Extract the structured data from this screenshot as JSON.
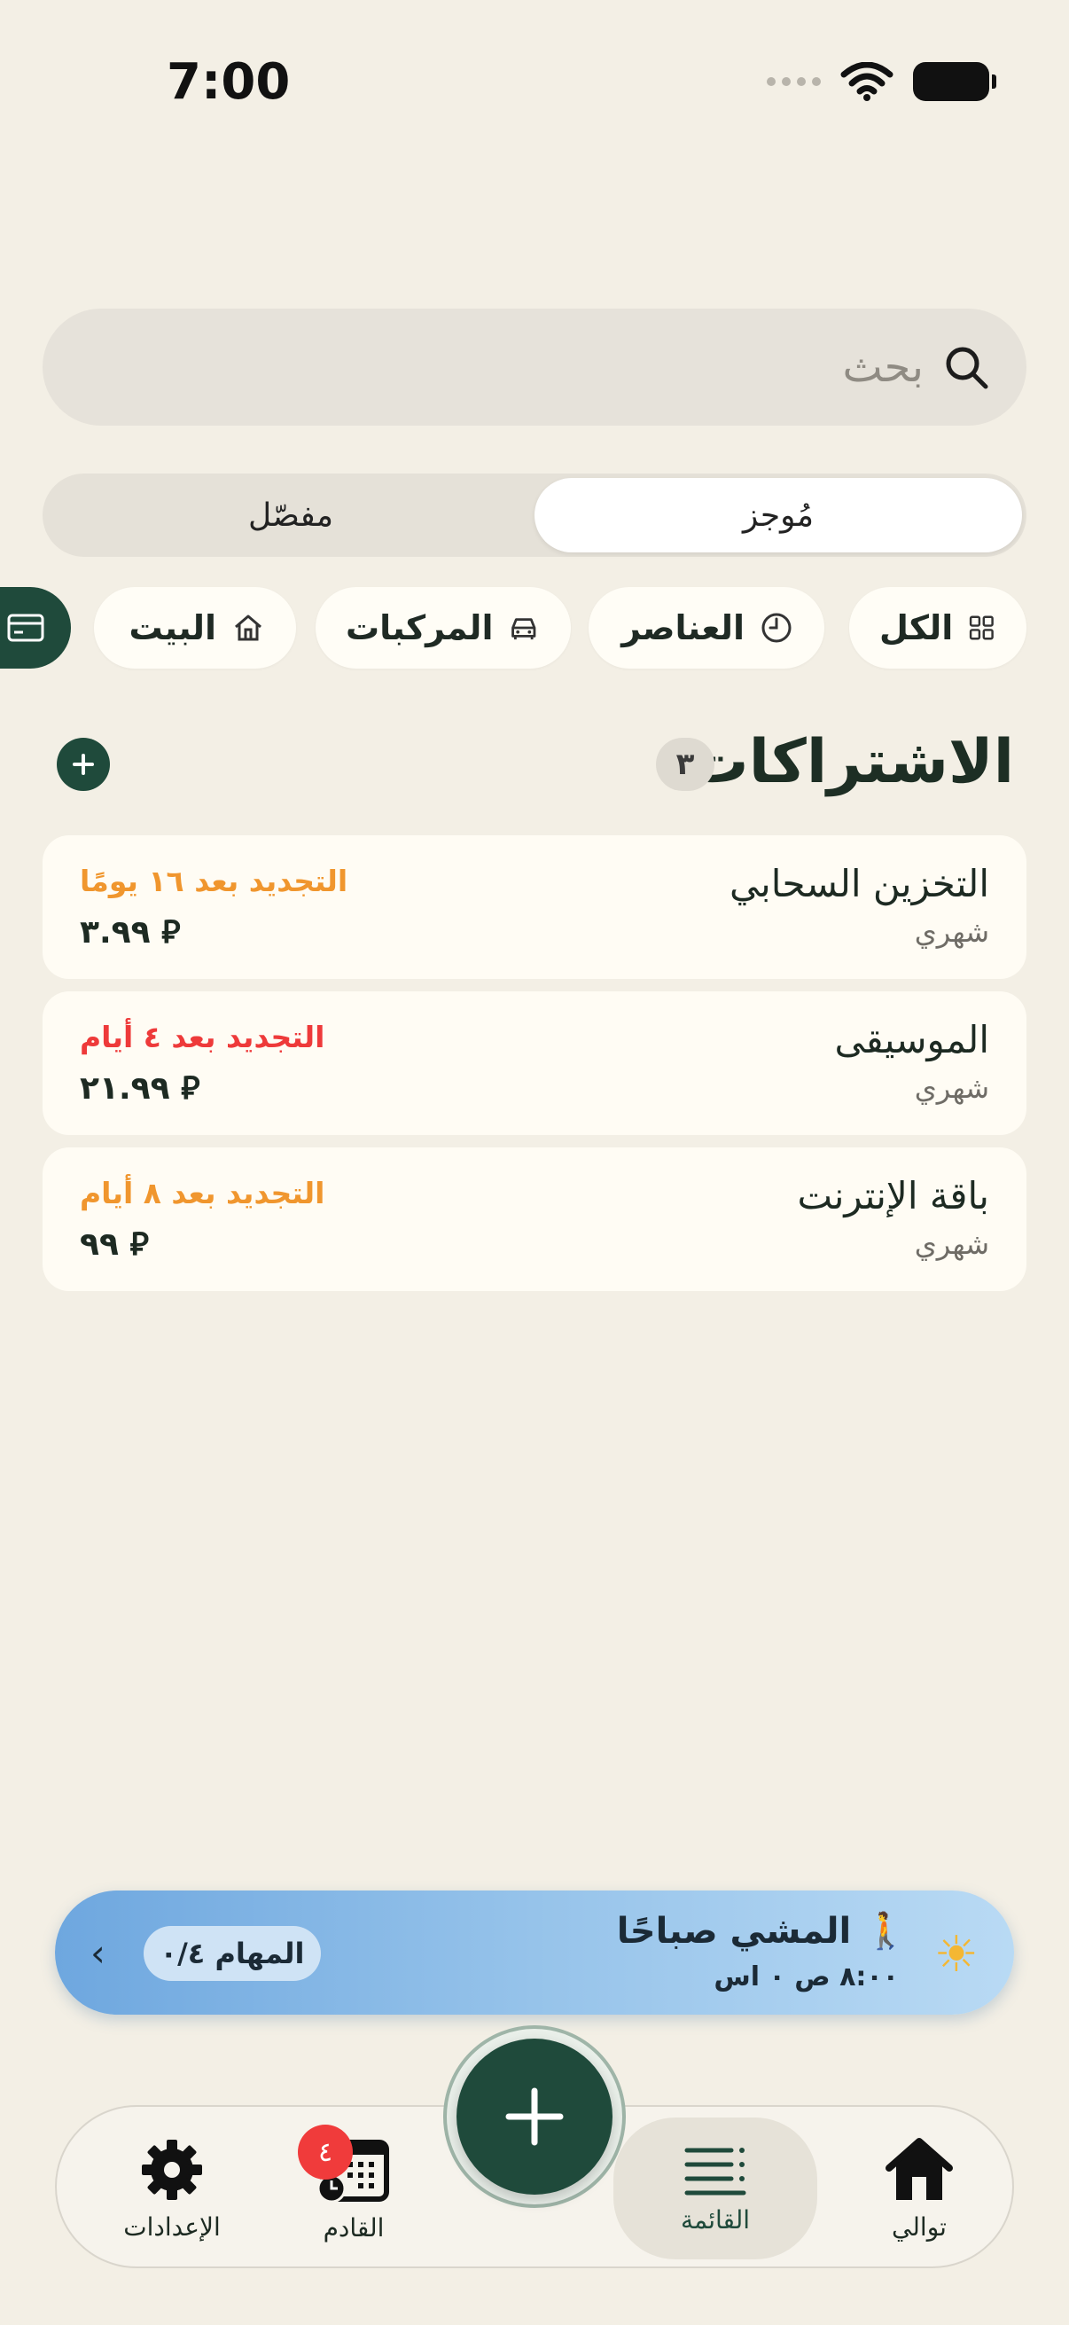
{
  "status_bar": {
    "time": "7:00"
  },
  "search": {
    "placeholder": "بحث"
  },
  "view_toggle": {
    "concise": "مُوجز",
    "detailed": "مفصّل",
    "selected": "concise"
  },
  "filters": [
    {
      "label": "الكل",
      "icon": "grid-icon"
    },
    {
      "label": "العناصر",
      "icon": "clock-icon"
    },
    {
      "label": "المركبات",
      "icon": "car-icon"
    },
    {
      "label": "البيت",
      "icon": "home-icon"
    },
    {
      "label": "",
      "icon": "card-icon"
    }
  ],
  "section": {
    "title": "الاشتراكات",
    "count": "٣"
  },
  "subscriptions": [
    {
      "name": "التخزين السحابي",
      "period": "شهري",
      "renewal": "التجديد بعد ١٦ يومًا",
      "renewal_color": "#f0962e",
      "price": "⃁ ٣.٩٩"
    },
    {
      "name": "الموسيقى",
      "period": "شهري",
      "renewal": "التجديد بعد ٤ أيام",
      "renewal_color": "#ee3a3a",
      "price": "⃁ ٢١.٩٩"
    },
    {
      "name": "باقة الإنترنت",
      "period": "شهري",
      "renewal": "التجديد بعد ٨ أيام",
      "renewal_color": "#f0962e",
      "price": "⃁ ٩٩"
    }
  ],
  "routine": {
    "title": "🚶 المشي صباحًا",
    "time": "٨:٠٠ ص ٠ اس",
    "tasks": "المهام ٠/٤"
  },
  "tabbar": {
    "home": "توالي",
    "list": "القائمة",
    "upcoming": "القادم",
    "upcoming_badge": "٤",
    "settings": "الإعدادات"
  },
  "colors": {
    "accent": "#1f4a3b",
    "background": "#f3efe5"
  }
}
